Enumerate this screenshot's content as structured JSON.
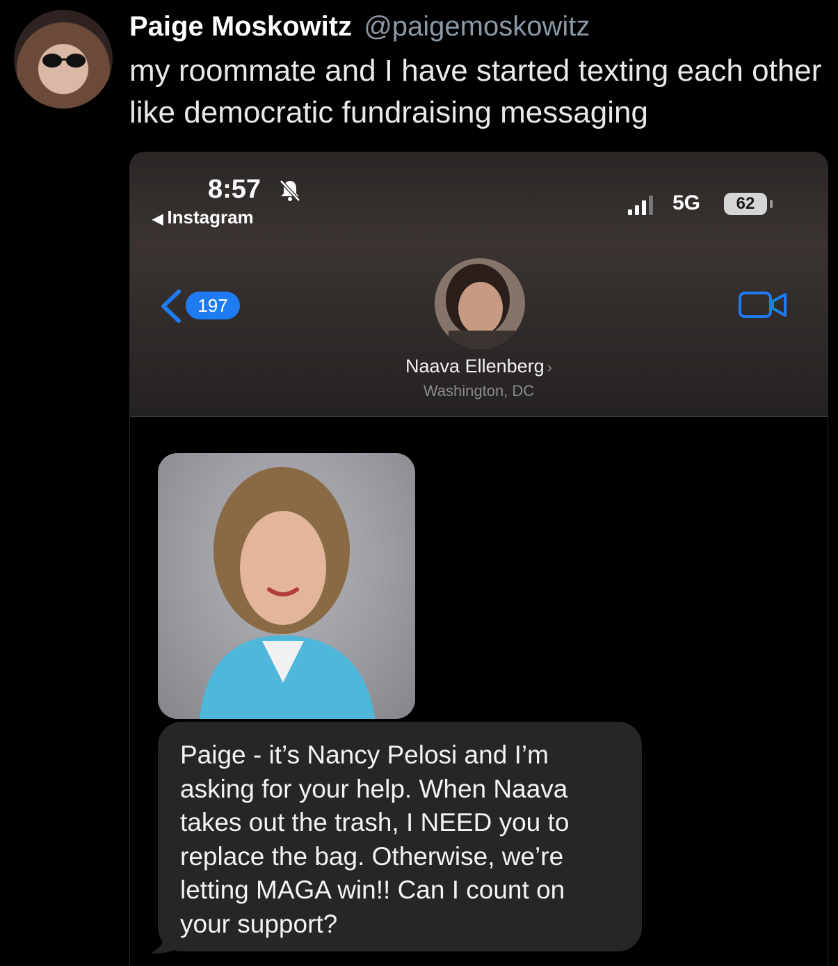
{
  "tweet": {
    "name": "Paige Moskowitz",
    "handle": "@paigemoskowitz",
    "text": "my roommate and I have started texting each other like democratic fundraising messaging"
  },
  "phone": {
    "status_bar": {
      "time": "8:57",
      "back_app": "Instagram",
      "network": "5G",
      "battery": "62"
    },
    "header": {
      "back_count": "197",
      "contact_name": "Naava Ellenberg",
      "contact_location": "Washington, DC"
    },
    "message": {
      "text": "Paige - it’s Nancy Pelosi and I’m asking for your help. When Naava takes out the trash, I NEED you to replace the bag. Otherwise, we’re letting MAGA win!! Can I count on your support?"
    }
  },
  "colors": {
    "background": "#000000",
    "accent_blue": "#1e7bf2",
    "bubble": "#262629",
    "handle_gray": "#8b98a5"
  }
}
